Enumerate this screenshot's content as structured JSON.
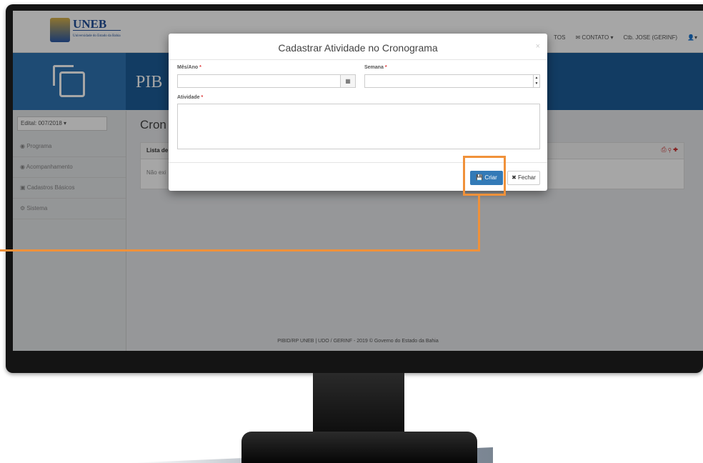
{
  "app": {
    "logo_text": "UNEB",
    "logo_subtext": "Universidade do Estado da Bahia",
    "banner_title": "PIB",
    "page_title": "Cron"
  },
  "navbar": {
    "contatos_partial": "TOS",
    "contato": "CONTATO",
    "user": "Ctb. JOSE (GERINF)"
  },
  "sidebar": {
    "edital": "Edital: 007/2018",
    "items": [
      {
        "label": "Programa",
        "icon": "eye-icon"
      },
      {
        "label": "Acompanhamento",
        "icon": "eye-icon"
      },
      {
        "label": "Cadastros Básicos",
        "icon": "car-icon"
      },
      {
        "label": "Sistema",
        "icon": "gears-icon"
      }
    ]
  },
  "panel": {
    "header": "Lista de",
    "body": "Não exi"
  },
  "modal": {
    "title": "Cadastrar Atividade no Cronograma",
    "close": "×",
    "label_mes_ano": "Mês/Ano",
    "label_semana": "Semana",
    "label_atividade": "Atividade",
    "required_marker": "*",
    "btn_criar": "Criar",
    "btn_fechar": "Fechar"
  },
  "footer": {
    "text": "PIBID/RP  UNEB  | UDO / GERINF - 2019 ©  Governo do Estado da Bahia"
  },
  "colors": {
    "highlight": "#f0913a",
    "primary": "#337ab7"
  }
}
